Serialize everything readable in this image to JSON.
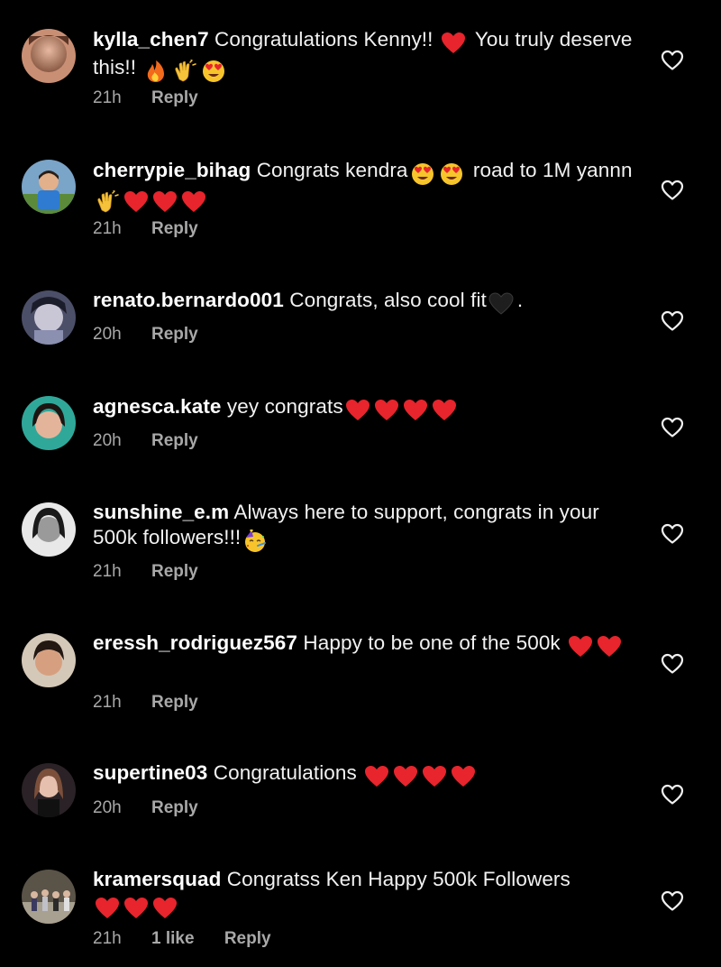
{
  "comments": [
    {
      "username": "kylla_chen7",
      "text_a": "Congratulations Kenny!!",
      "emojis_a": [
        "red-heart"
      ],
      "text_b": "You truly deserve this!!",
      "emojis_b": [
        "fire",
        "clapping-hands",
        "heart-eyes"
      ],
      "time": "21h",
      "likes": "",
      "reply_label": "Reply"
    },
    {
      "username": "cherrypie_bihag",
      "text_a": "Congrats kendra",
      "emojis_a": [
        "heart-eyes",
        "heart-eyes"
      ],
      "text_b": "road to 1M yannn",
      "emojis_b": [
        "clapping-hands",
        "red-heart",
        "red-heart",
        "red-heart"
      ],
      "time": "21h",
      "likes": "",
      "reply_label": "Reply"
    },
    {
      "username": "renato.bernardo001",
      "text_a": "Congrats, also cool fit",
      "emojis_a": [
        "black-heart"
      ],
      "text_b": ".",
      "emojis_b": [],
      "time": "20h",
      "likes": "",
      "reply_label": "Reply"
    },
    {
      "username": "agnesca.kate",
      "text_a": "yey congrats",
      "emojis_a": [
        "red-heart",
        "red-heart",
        "red-heart",
        "red-heart"
      ],
      "text_b": "",
      "emojis_b": [],
      "time": "20h",
      "likes": "",
      "reply_label": "Reply"
    },
    {
      "username": "sunshine_e.m",
      "text_a": "Always here to support, congrats in your 500k followers!!!",
      "emojis_a": [
        "partying-face"
      ],
      "text_b": "",
      "emojis_b": [],
      "time": "21h",
      "likes": "",
      "reply_label": "Reply"
    },
    {
      "username": "eressh_rodriguez567",
      "text_a": "Happy to be one of the 500k",
      "emojis_a": [
        "red-heart",
        "red-heart"
      ],
      "text_b": "",
      "emojis_b": [],
      "time": "21h",
      "likes": "",
      "reply_label": "Reply"
    },
    {
      "username": "supertine03",
      "text_a": "Congratulations",
      "emojis_a": [
        "red-heart",
        "red-heart",
        "red-heart",
        "red-heart"
      ],
      "text_b": "",
      "emojis_b": [],
      "time": "20h",
      "likes": "",
      "reply_label": "Reply"
    },
    {
      "username": "kramersquad",
      "text_a": "Congratss Ken Happy 500k Followers",
      "emojis_a": [
        "red-heart",
        "red-heart",
        "red-heart"
      ],
      "text_b": "",
      "emojis_b": [],
      "time": "21h",
      "likes": "1 like",
      "reply_label": "Reply"
    }
  ],
  "colors": {
    "background": "#000000",
    "text": "#f2f2f2",
    "meta": "#a8a8a8",
    "heart_red": "#e8242c"
  },
  "icons": {
    "like_button": "heart-outline-icon"
  }
}
